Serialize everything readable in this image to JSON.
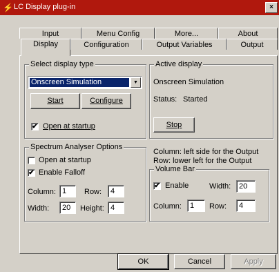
{
  "window": {
    "title": "LC Display plug-in",
    "close_glyph": "×"
  },
  "tabs_row1": [
    "Input",
    "Menu Config",
    "More...",
    "About"
  ],
  "tabs_row2": [
    "Display",
    "Configuration",
    "Output Variables",
    "Output"
  ],
  "active_tab": "Display",
  "select_display_type": {
    "legend": "Select display type",
    "selected": "Onscreen Simulation",
    "start_label": "Start",
    "configure_label": "Configure",
    "open_at_startup_label": "Open at startup",
    "open_at_startup_checked": true
  },
  "active_display": {
    "legend": "Active display",
    "name": "Onscreen Simulation",
    "status_label": "Status:",
    "status_value": "Started",
    "stop_label": "Stop"
  },
  "spectrum": {
    "legend": "Spectrum Analyser Options",
    "open_at_startup_label": "Open at startup",
    "open_at_startup_checked": false,
    "enable_falloff_label": "Enable Falloff",
    "enable_falloff_checked": true,
    "column_label": "Column:",
    "column_value": "1",
    "row_label": "Row:",
    "row_value": "4",
    "width_label": "Width:",
    "width_value": "20",
    "height_label": "Height:",
    "height_value": "4"
  },
  "notes": {
    "line1": "Column: left side for the Output",
    "line2": "Row: lower left for the Output"
  },
  "volume_bar": {
    "legend": "Volume Bar",
    "enable_label": "Enable",
    "enable_checked": true,
    "width_label": "Width:",
    "width_value": "20",
    "column_label": "Column:",
    "column_value": "1",
    "row_label": "Row:",
    "row_value": "4"
  },
  "footer": {
    "ok": "OK",
    "cancel": "Cancel",
    "apply": "Apply"
  },
  "check_glyph": "✔",
  "colors": {
    "titlebar": "#b0180d",
    "face": "#d4d0c8",
    "selection": "#0a246a"
  }
}
